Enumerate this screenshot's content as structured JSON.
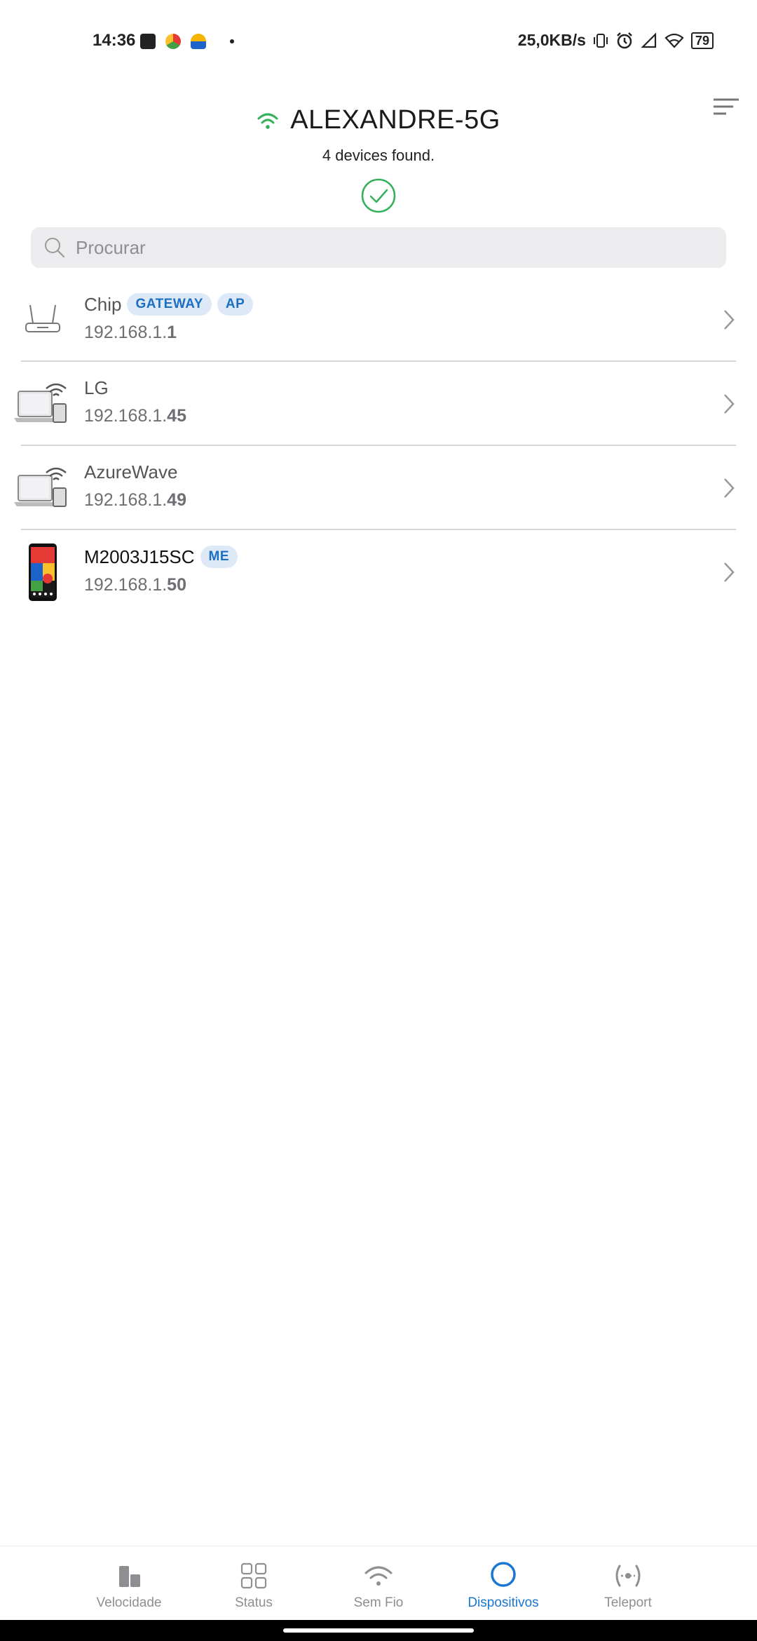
{
  "status_bar": {
    "time": "14:36",
    "net_speed": "25,0KB/s",
    "battery": "79"
  },
  "header": {
    "ssid": "ALEXANDRE-5G",
    "found_text": "4 devices found.",
    "accent_color": "#34b05a"
  },
  "search": {
    "placeholder": "Procurar"
  },
  "devices": [
    {
      "name": "Chip",
      "badges": [
        "GATEWAY",
        "AP"
      ],
      "ip_prefix": "192.168.1.",
      "ip_suffix": "1",
      "icon": "router-icon"
    },
    {
      "name": "LG",
      "badges": [],
      "ip_prefix": "192.168.1.",
      "ip_suffix": "45",
      "icon": "laptop-wifi-icon"
    },
    {
      "name": "AzureWave",
      "badges": [],
      "ip_prefix": "192.168.1.",
      "ip_suffix": "49",
      "icon": "laptop-wifi-icon"
    },
    {
      "name": "M2003J15SC",
      "badges": [
        "ME"
      ],
      "ip_prefix": "192.168.1.",
      "ip_suffix": "50",
      "icon": "phone-icon"
    }
  ],
  "nav": {
    "items": [
      {
        "label": "Velocidade",
        "icon": "speed-bars-icon"
      },
      {
        "label": "Status",
        "icon": "grid-icon"
      },
      {
        "label": "Sem Fio",
        "icon": "wifi-icon"
      },
      {
        "label": "Dispositivos",
        "icon": "circle-icon"
      },
      {
        "label": "Teleport",
        "icon": "teleport-icon"
      }
    ],
    "active_color": "#1976d2"
  }
}
